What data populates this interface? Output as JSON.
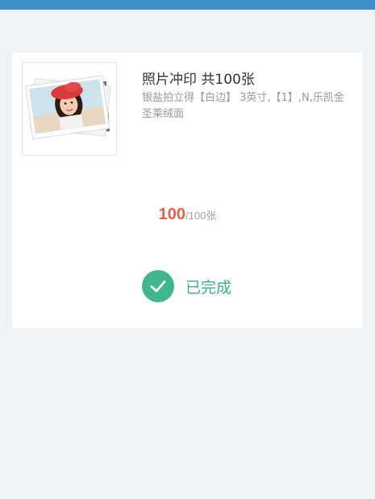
{
  "order": {
    "title": "照片冲印 共100张",
    "description": "银盐拍立得【白边】 3英寸,【1】,N,乐凯金圣莱绒面",
    "thumbnail": "photo-stack-image"
  },
  "progress": {
    "current": "100",
    "separator": "/",
    "total": "100张",
    "fraction": 1.0
  },
  "status": {
    "label": "已完成",
    "icon": "check-circle-icon",
    "color": "#41b58f"
  },
  "colors": {
    "topbar": "#3f8fcb",
    "background": "#eef3f6",
    "accent_number": "#e2614a"
  }
}
